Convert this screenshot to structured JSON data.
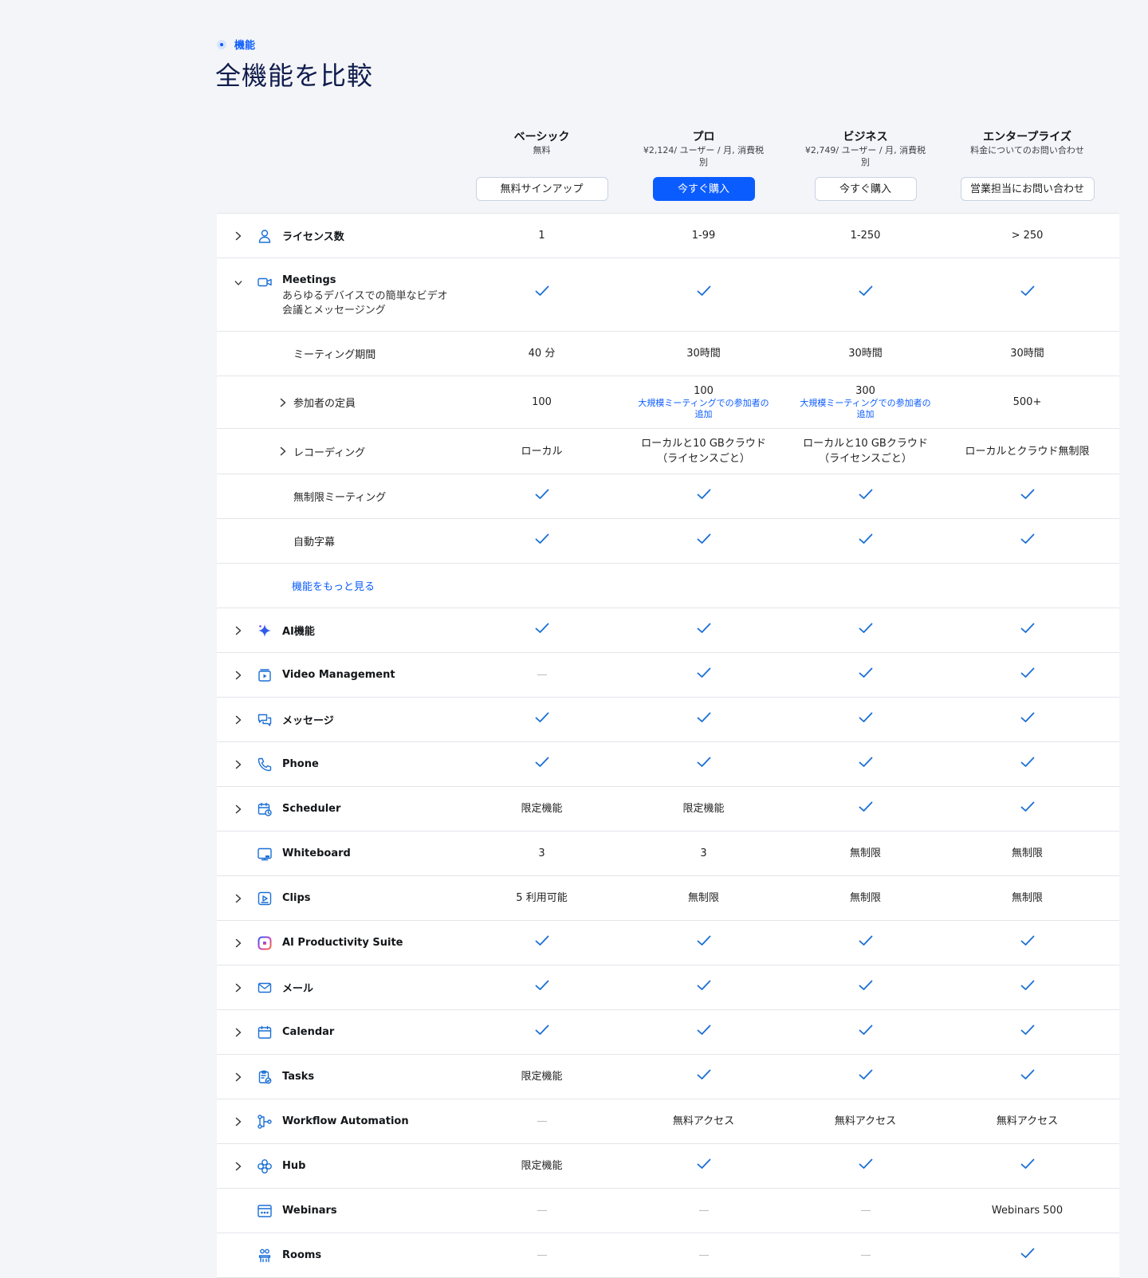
{
  "section": {
    "eyebrow": "機能",
    "title": "全機能を比較"
  },
  "plans": [
    {
      "name": "ベーシック",
      "price": "無料",
      "button": "無料サインアップ",
      "primary": false
    },
    {
      "name": "プロ",
      "price": "¥2,124/ ユーザー / 月, 消費税別",
      "button": "今すぐ購入",
      "primary": true
    },
    {
      "name": "ビジネス",
      "price": "¥2,749/ ユーザー / 月, 消費税別",
      "button": "今すぐ購入",
      "primary": false
    },
    {
      "name": "エンタープライズ",
      "price": "料金についてのお問い合わせ",
      "button": "営業担当にお問い合わせ",
      "primary": false
    }
  ],
  "rows": {
    "licenses": {
      "label": "ライセンス数",
      "values": [
        "1",
        "1-99",
        "1-250",
        "> 250"
      ]
    },
    "meetings": {
      "label": "Meetings",
      "desc": "あらゆるデバイスでの簡単なビデオ会議とメッセージング"
    },
    "duration": {
      "label": "ミーティング期間",
      "values": [
        "40 分",
        "30時間",
        "30時間",
        "30時間"
      ]
    },
    "participants": {
      "label": "参加者の定員",
      "values": [
        "100",
        "100",
        "300",
        "500+"
      ],
      "addon": "大規模ミーティングでの参加者の追加"
    },
    "recording": {
      "label": "レコーディング",
      "values": [
        "ローカル",
        "ローカルと10 GBクラウド（ライセンスごと）",
        "ローカルと10 GBクラウド（ライセンスごと）",
        "ローカルとクラウド無制限"
      ]
    },
    "unlimited": {
      "label": "無制限ミーティング"
    },
    "captions": {
      "label": "自動字幕"
    },
    "more": {
      "label": "機能をもっと見る"
    },
    "ai": {
      "label": "AI機能"
    },
    "video_mgmt": {
      "label": "Video Management"
    },
    "messages": {
      "label": "メッセージ"
    },
    "phone": {
      "label": "Phone"
    },
    "scheduler": {
      "label": "Scheduler",
      "values": [
        "限定機能",
        "限定機能"
      ]
    },
    "whiteboard": {
      "label": "Whiteboard",
      "values": [
        "3",
        "3",
        "無制限",
        "無制限"
      ]
    },
    "clips": {
      "label": "Clips",
      "values": [
        "5 利用可能",
        "無制限",
        "無制限",
        "無制限"
      ]
    },
    "ai_suite": {
      "label": "AI Productivity Suite"
    },
    "mail": {
      "label": "メール"
    },
    "calendar": {
      "label": "Calendar"
    },
    "tasks": {
      "label": "Tasks",
      "values": [
        "限定機能"
      ]
    },
    "workflow": {
      "label": "Workflow Automation",
      "values": [
        "無料アクセス",
        "無料アクセス",
        "無料アクセス"
      ]
    },
    "hub": {
      "label": "Hub",
      "values": [
        "限定機能"
      ]
    },
    "webinars": {
      "label": "Webinars",
      "values": [
        "Webinars 500"
      ]
    },
    "rooms": {
      "label": "Rooms"
    }
  },
  "colors": {
    "accent": "#0b5cff",
    "check": "#1a6fd6",
    "title": "#0f1c4d"
  }
}
